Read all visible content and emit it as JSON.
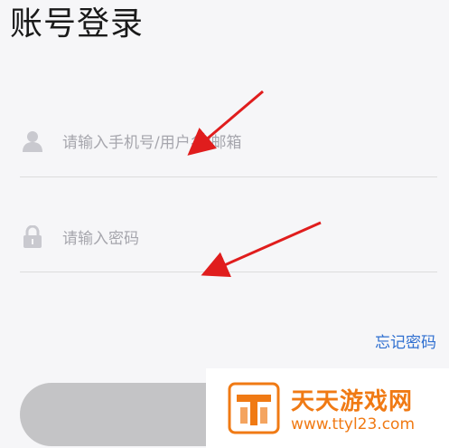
{
  "header": {
    "title": "账号登录"
  },
  "form": {
    "username_placeholder": "请输入手机号/用户名/邮箱",
    "password_placeholder": "请输入密码"
  },
  "links": {
    "forgot_password": "忘记密码"
  },
  "watermark": {
    "title": "天天游戏网",
    "url": "www.ttyl23.com"
  },
  "icons": {
    "user": "user-icon",
    "lock": "lock-icon"
  },
  "colors": {
    "link": "#2f6fd0",
    "annotation_arrow": "#e01d1d",
    "watermark": "#f07a14"
  }
}
